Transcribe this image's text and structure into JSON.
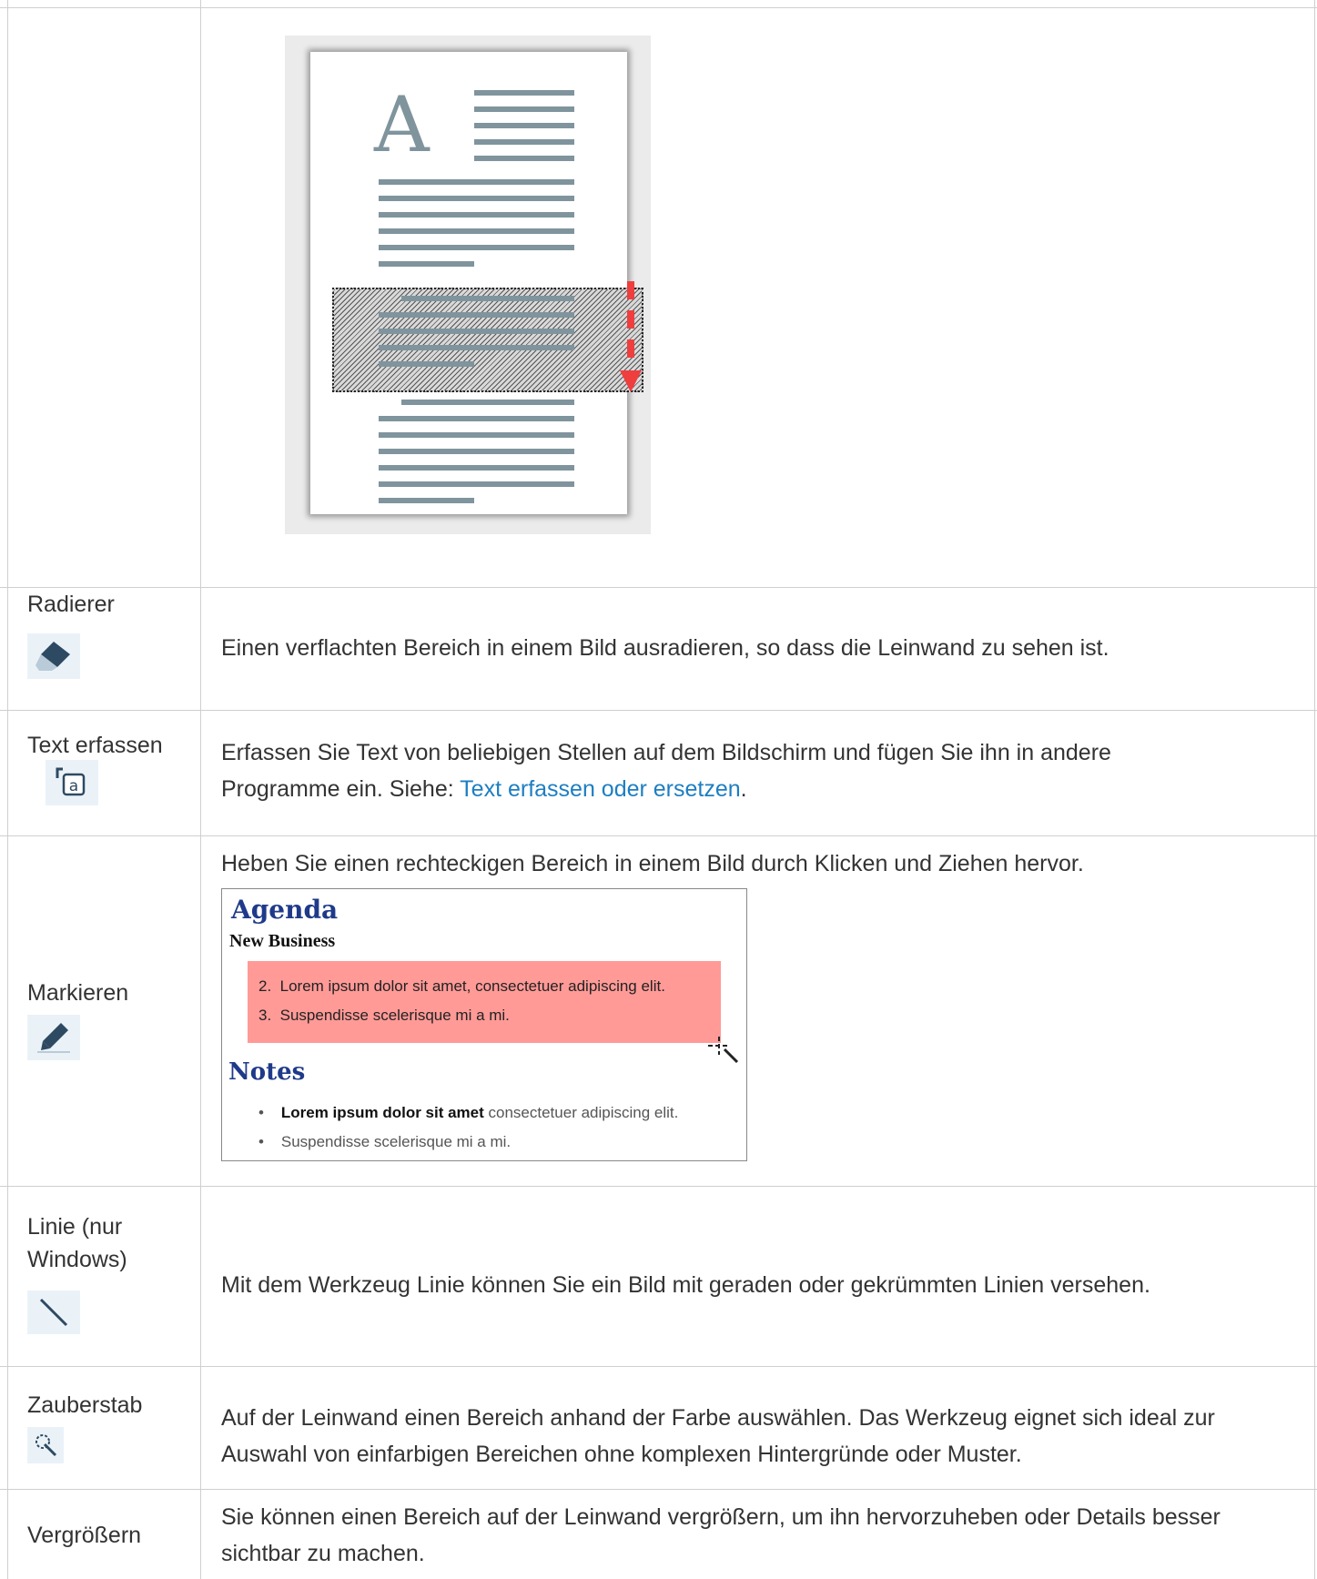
{
  "rows": {
    "radierer": {
      "name": "Radierer",
      "description": "Einen verflachten Bereich in einem Bild ausradieren, so dass die Leinwand zu sehen ist."
    },
    "text_erfassen": {
      "name": "Text erfassen",
      "description_part1": "Erfassen Sie Text von beliebigen Stellen auf dem Bildschirm und fügen Sie ihn in andere",
      "description_part2": "Programme ein. Siehe: ",
      "link": "Text erfassen oder ersetzen",
      "description_end": "."
    },
    "markieren": {
      "name": "Markieren",
      "description": "Heben Sie einen rechteckigen Bereich in einem Bild durch Klicken und Ziehen hervor.",
      "example": {
        "title": "Agenda",
        "subtitle": "New Business",
        "items": [
          "2.  Lorem ipsum dolor sit amet, consectetuer adipiscing elit.",
          "3.  Suspendisse scelerisque mi a mi."
        ],
        "notes_title": "Notes",
        "bullet1_bold": "Lorem ipsum dolor sit amet",
        "bullet1_rest": " consectetuer adipiscing elit.",
        "bullet2": "Suspendisse scelerisque mi a mi.",
        "highlight_color": "#ff9a97"
      }
    },
    "linie": {
      "name_line1": "Linie (nur",
      "name_line2": "Windows)",
      "description": "Mit dem Werkzeug Linie können Sie ein Bild mit geraden oder gekrümmten Linien versehen."
    },
    "zauberstab": {
      "name": "Zauberstab",
      "description_line1": "Auf der Leinwand einen Bereich anhand der Farbe auswählen. Das Werkzeug eignet sich ideal zur",
      "description_line2": "Auswahl von einfarbigen Bereichen ohne komplexen Hintergründe oder Muster."
    },
    "vergroessern": {
      "name": "Vergrößern",
      "description_line1": "Sie können einen Bereich auf der Leinwand vergrößern, um ihn hervorzuheben oder Details besser",
      "description_line2": "sichtbar zu machen."
    }
  },
  "colors": {
    "link": "#1d7ec2",
    "icon_bg": "#eaf2f8",
    "arrow": "#ef3e3e"
  },
  "icons": [
    "eraser-icon",
    "text-capture-icon",
    "highlighter-icon",
    "line-icon",
    "magic-wand-icon"
  ]
}
